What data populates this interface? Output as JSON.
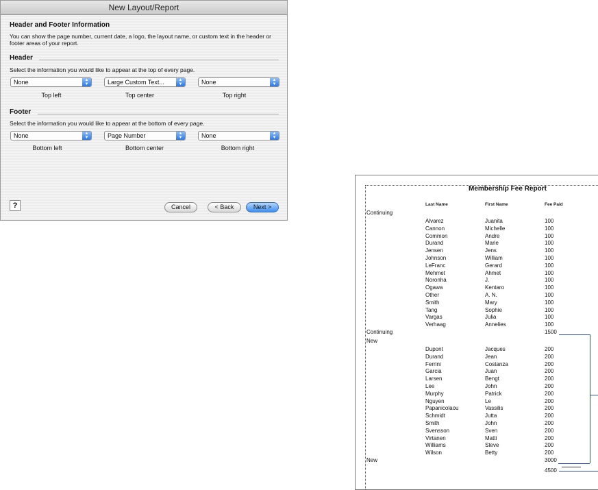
{
  "window": {
    "title": "New Layout/Report"
  },
  "dialog": {
    "heading": "Header and Footer Information",
    "description": "You can show the page number, current date, a logo, the layout name, or custom text in the header or footer areas of your report.",
    "header": {
      "section_label": "Header",
      "instruction": "Select the information you would like to appear at the top of every page.",
      "left": {
        "value": "None",
        "label": "Top left"
      },
      "center": {
        "value": "Large Custom Text...",
        "label": "Top center"
      },
      "right": {
        "value": "None",
        "label": "Top right"
      }
    },
    "footer": {
      "section_label": "Footer",
      "instruction": "Select the information you would like to appear at the bottom of every page.",
      "left": {
        "value": "None",
        "label": "Bottom left"
      },
      "center": {
        "value": "Page Number",
        "label": "Bottom center"
      },
      "right": {
        "value": "None",
        "label": "Bottom right"
      }
    },
    "buttons": {
      "help": "?",
      "cancel": "Cancel",
      "back": "< Back",
      "next": "Next >"
    }
  },
  "report": {
    "title": "Membership Fee Report",
    "columns": {
      "last": "Last Name",
      "first": "First Name",
      "fee": "Fee Paid"
    },
    "groups": [
      {
        "name": "Continuing",
        "rows": [
          [
            "Alvarez",
            "Juanita",
            "100"
          ],
          [
            "Cannon",
            "Michelle",
            "100"
          ],
          [
            "Common",
            "Andre",
            "100"
          ],
          [
            "Durand",
            "Marie",
            "100"
          ],
          [
            "Jensen",
            "Jens",
            "100"
          ],
          [
            "Johnson",
            "William",
            "100"
          ],
          [
            "LeFranc",
            "Gerard",
            "100"
          ],
          [
            "Mehmet",
            "Ahmet",
            "100"
          ],
          [
            "Noronha",
            "J.",
            "100"
          ],
          [
            "Ogawa",
            "Kentaro",
            "100"
          ],
          [
            "Other",
            "A. N.",
            "100"
          ],
          [
            "Smith",
            "Mary",
            "100"
          ],
          [
            "Tang",
            "Sophie",
            "100"
          ],
          [
            "Vargas",
            "Julia",
            "100"
          ],
          [
            "Verhaag",
            "Annelies",
            "100"
          ]
        ],
        "subtotal": "1500"
      },
      {
        "name": "New",
        "rows": [
          [
            "Dupont",
            "Jacques",
            "200"
          ],
          [
            "Durand",
            "Jean",
            "200"
          ],
          [
            "Ferrini",
            "Costanza",
            "200"
          ],
          [
            "Garcia",
            "Juan",
            "200"
          ],
          [
            "Larsen",
            "Bengt",
            "200"
          ],
          [
            "Lee",
            "John",
            "200"
          ],
          [
            "Murphy",
            "Patrick",
            "200"
          ],
          [
            "Nguyen",
            "Le",
            "200"
          ],
          [
            "Papanicolaou",
            "Vassilis",
            "200"
          ],
          [
            "Schmidt",
            "Jutta",
            "200"
          ],
          [
            "Smith",
            "John",
            "200"
          ],
          [
            "Svensson",
            "Sven",
            "200"
          ],
          [
            "Virtanen",
            "Matti",
            "200"
          ],
          [
            "Williams",
            "Steve",
            "200"
          ],
          [
            "Wilson",
            "Betty",
            "200"
          ]
        ],
        "subtotal": "3000"
      }
    ],
    "grand_total": "4500"
  }
}
